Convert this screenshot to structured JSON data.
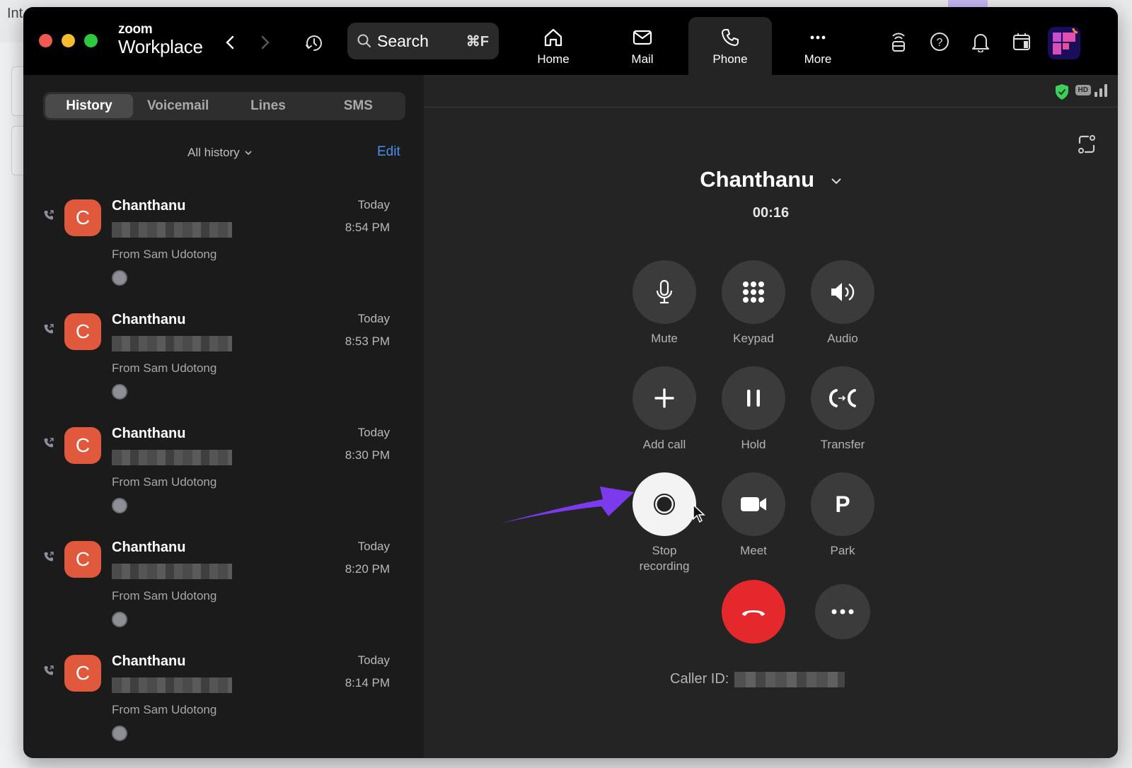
{
  "background": {
    "partial_text": "Int"
  },
  "titlebar": {
    "brand_top": "zoom",
    "brand_main": "Workplace",
    "search": {
      "label": "Search",
      "shortcut": "⌘F"
    },
    "nav_tabs": [
      {
        "label": "Home",
        "icon": "home-icon",
        "active": false
      },
      {
        "label": "Mail",
        "icon": "mail-icon",
        "active": false
      },
      {
        "label": "Phone",
        "icon": "phone-icon",
        "active": true
      },
      {
        "label": "More",
        "icon": "more-icon",
        "active": false
      }
    ],
    "right_icons": [
      "presence-icon",
      "help-icon",
      "bell-icon",
      "calendar-icon",
      "app-avatar"
    ]
  },
  "left_panel": {
    "tabs": [
      {
        "label": "History",
        "active": true
      },
      {
        "label": "Voicemail",
        "active": false
      },
      {
        "label": "Lines",
        "active": false
      },
      {
        "label": "SMS",
        "active": false
      }
    ],
    "filter_label": "All history",
    "edit_label": "Edit",
    "history": [
      {
        "initial": "C",
        "name": "Chanthanu",
        "number": "[redacted]",
        "from": "From Sam Udotong",
        "day": "Today",
        "time": "8:54 PM"
      },
      {
        "initial": "C",
        "name": "Chanthanu",
        "number": "[redacted]",
        "from": "From Sam Udotong",
        "day": "Today",
        "time": "8:53 PM"
      },
      {
        "initial": "C",
        "name": "Chanthanu",
        "number": "[redacted]",
        "from": "From Sam Udotong",
        "day": "Today",
        "time": "8:30 PM"
      },
      {
        "initial": "C",
        "name": "Chanthanu",
        "number": "[redacted]",
        "from": "From Sam Udotong",
        "day": "Today",
        "time": "8:20 PM"
      },
      {
        "initial": "C",
        "name": "Chanthanu",
        "number": "[redacted]",
        "from": "From Sam Udotong",
        "day": "Today",
        "time": "8:14 PM"
      }
    ]
  },
  "call": {
    "status_icons": {
      "encryption": "shield-check-icon",
      "quality": "HD",
      "signal": "signal-icon"
    },
    "caller_name": "Chanthanu",
    "timer": "00:16",
    "controls": [
      {
        "label": "Mute",
        "icon": "microphone-icon"
      },
      {
        "label": "Keypad",
        "icon": "keypad-icon"
      },
      {
        "label": "Audio",
        "icon": "speaker-icon"
      },
      {
        "label": "Add call",
        "icon": "plus-icon"
      },
      {
        "label": "Hold",
        "icon": "pause-icon"
      },
      {
        "label": "Transfer",
        "icon": "transfer-icon"
      },
      {
        "label": "Stop recording",
        "icon": "record-icon",
        "active": true
      },
      {
        "label": "Meet",
        "icon": "video-icon"
      },
      {
        "label": "Park",
        "icon": "park-icon"
      }
    ],
    "end_call_icon": "hangup-icon",
    "more_icon": "more-icon",
    "caller_id_label": "Caller ID:",
    "caller_id_value": "[redacted]"
  },
  "colors": {
    "avatar": "#e0593d",
    "end_call": "#e5282b",
    "edit_link": "#4a8fe8",
    "annotation_arrow": "#7c3aed",
    "shield": "#3ecf5a"
  }
}
